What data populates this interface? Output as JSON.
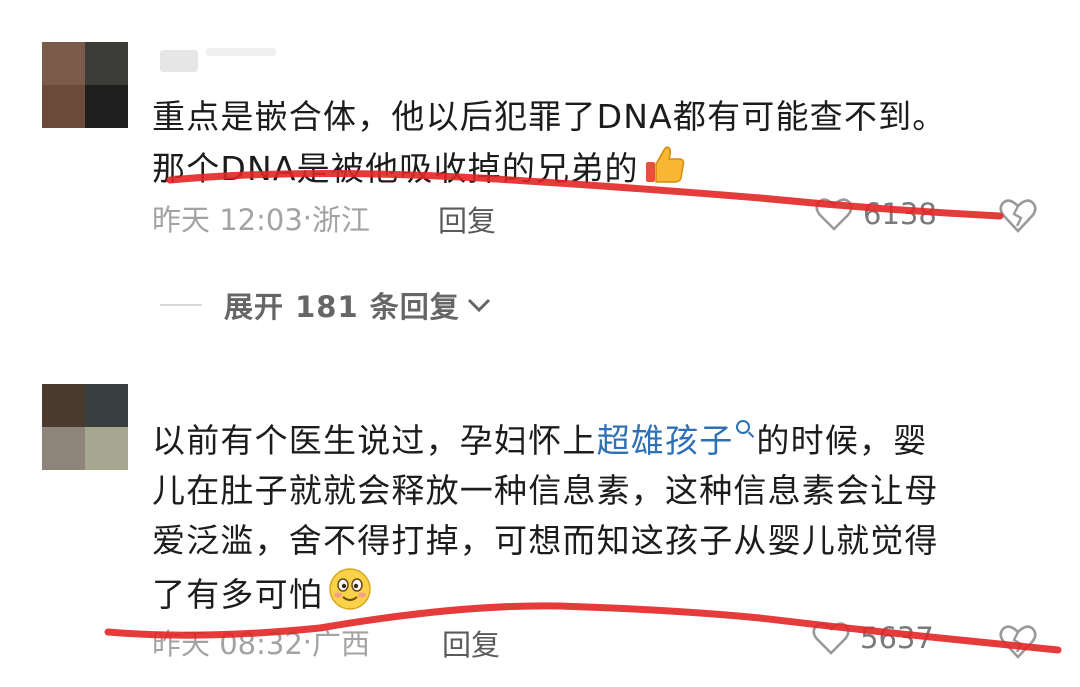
{
  "comments": [
    {
      "text_lines": [
        "重点是嵌合体，他以后犯罪了DNA都有可能查不到。",
        "那个DNA是被他吸收掉的兄弟的"
      ],
      "emoji": "thumbs-up",
      "time": "昨天 12:03",
      "location": "浙江",
      "reply_label": "回复",
      "likes": "6138",
      "expand_label": "展开 181 条回复"
    },
    {
      "text_before": "以前有个医生说过，孕妇怀上",
      "link_text": "超雄孩子",
      "text_after_line1": "的时候，婴",
      "text_lines_rest": [
        "儿在肚子就就会释放一种信息素，这种信息素会让母",
        "爱泛滥，舍不得打掉，可想而知这孩子从婴儿就觉得",
        "了有多可怕"
      ],
      "emoji": "smiling-face",
      "time": "昨天 08:32",
      "location": "广西",
      "reply_label": "回复",
      "likes": "5637"
    }
  ],
  "colors": {
    "link": "#2f6fb3",
    "annotation_stroke": "#e32626",
    "meta_text": "#a3a3a3"
  }
}
